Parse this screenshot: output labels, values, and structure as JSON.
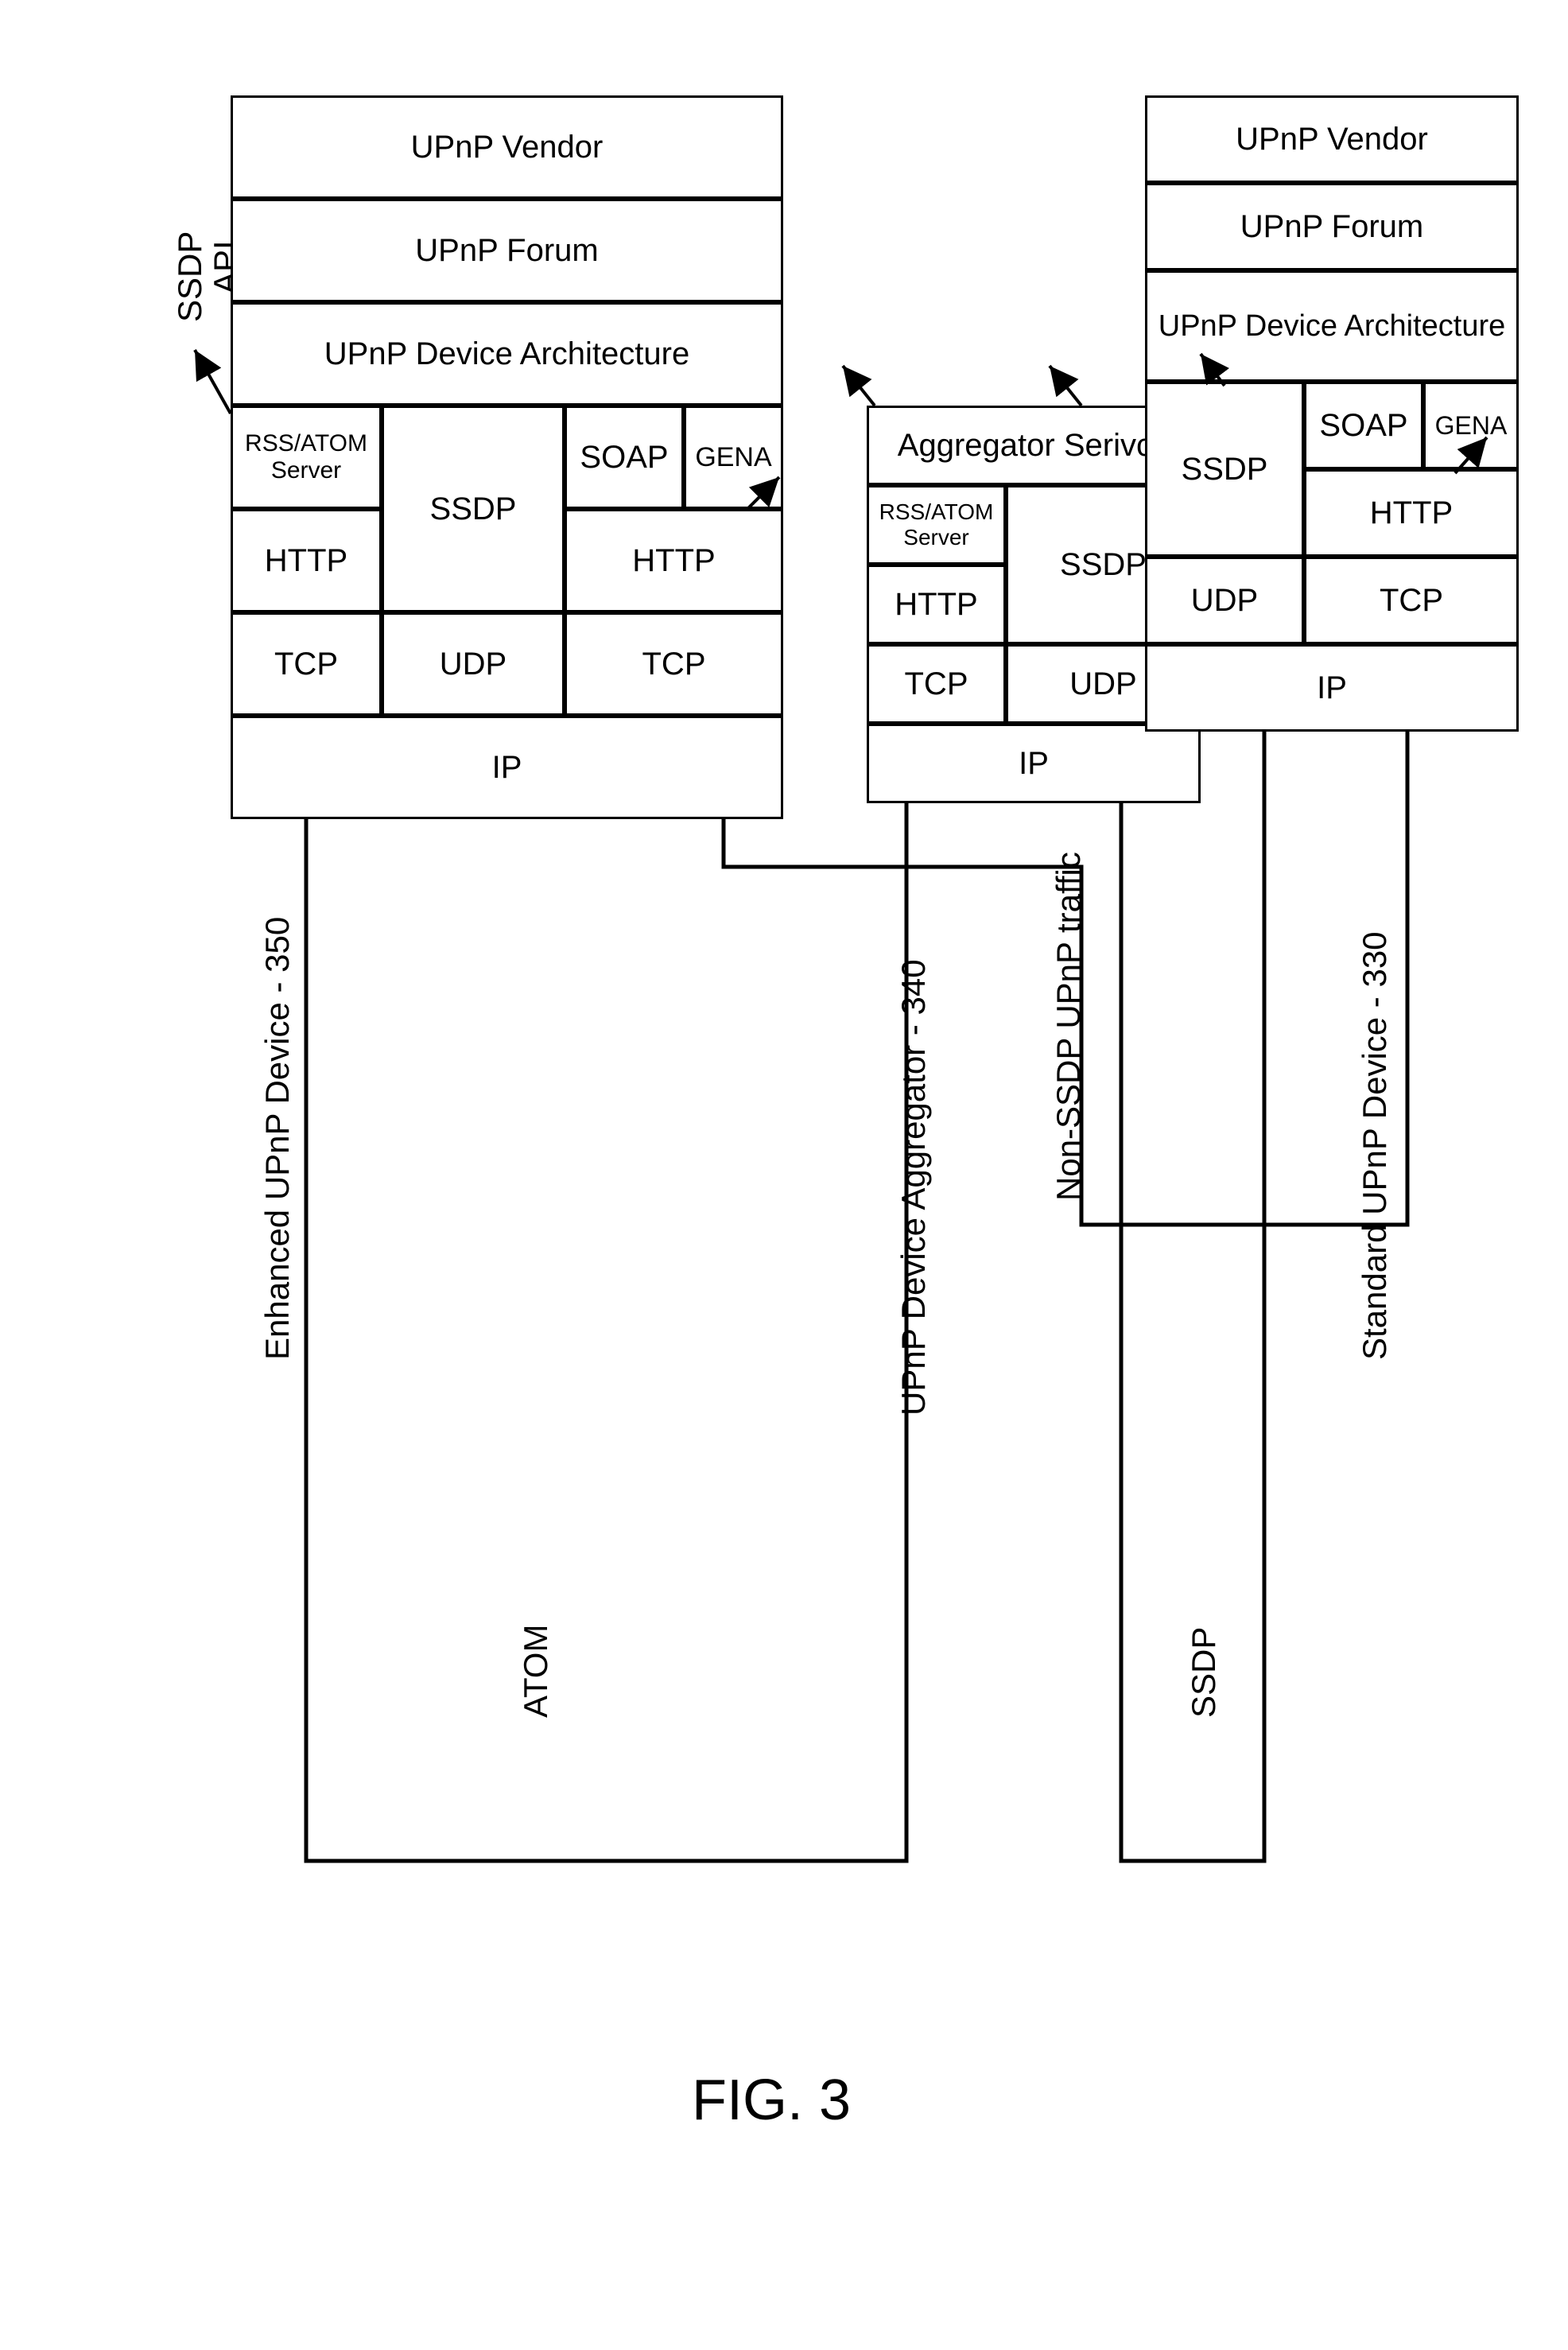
{
  "figure_label": "FIG. 3",
  "ssdp_api_label_1": "SSDP",
  "ssdp_api_label_2": "API",
  "enhanced": {
    "caption": "Enhanced UPnP Device - 350",
    "vendor": "UPnP Vendor",
    "forum": "UPnP Forum",
    "arch": "UPnP Device Architecture",
    "rss_atom_server": "RSS/ATOM Server",
    "ssdp": "SSDP",
    "soap": "SOAP",
    "gena": "GENA",
    "http_left": "HTTP",
    "http_right": "HTTP",
    "tcp_left": "TCP",
    "udp": "UDP",
    "tcp_right": "TCP",
    "ip": "IP"
  },
  "aggregator": {
    "caption": "UPnP Device Aggregator - 340",
    "service": "Aggregator Serivce",
    "rss_atom_server": "RSS/ATOM Server",
    "ssdp": "SSDP",
    "http": "HTTP",
    "tcp": "TCP",
    "udp": "UDP",
    "ip": "IP"
  },
  "standard": {
    "caption": "Standard UPnP Device - 330",
    "vendor": "UPnP Vendor",
    "forum": "UPnP Forum",
    "arch": "UPnP Device Architecture",
    "ssdp": "SSDP",
    "soap": "SOAP",
    "gena": "GENA",
    "http": "HTTP",
    "tcp": "TCP",
    "udp": "UDP",
    "ip": "IP"
  },
  "links": {
    "atom": "ATOM",
    "non_ssdp": "Non-SSDP UPnP traffic",
    "ssdp": "SSDP"
  }
}
